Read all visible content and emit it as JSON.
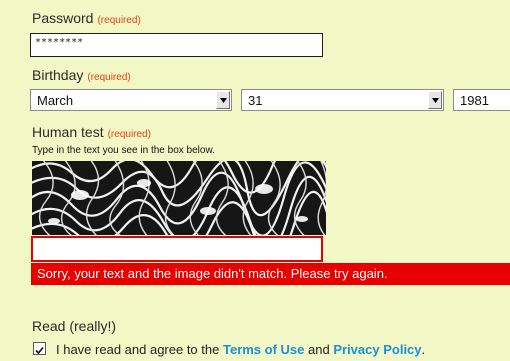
{
  "password": {
    "label": "Password",
    "required": "(required)",
    "value": "********"
  },
  "birthday": {
    "label": "Birthday",
    "required": "(required)",
    "month": "March",
    "day": "31",
    "year": "1981"
  },
  "human_test": {
    "label": "Human test",
    "required": "(required)",
    "hint": "Type in the text you see in the box below.",
    "value": "",
    "error": "Sorry, your text and the image didn't match. Please try again."
  },
  "read": {
    "label": "Read (really!)",
    "checked": true,
    "agree_prefix": "I have read and agree to the",
    "terms_link": "Terms of Use",
    "and": "and",
    "privacy_link": "Privacy Policy",
    "suffix": "."
  },
  "colors": {
    "background": "#f2f7c6",
    "required": "#e8430e",
    "error": "#e60000",
    "link": "#1b8fd8"
  }
}
